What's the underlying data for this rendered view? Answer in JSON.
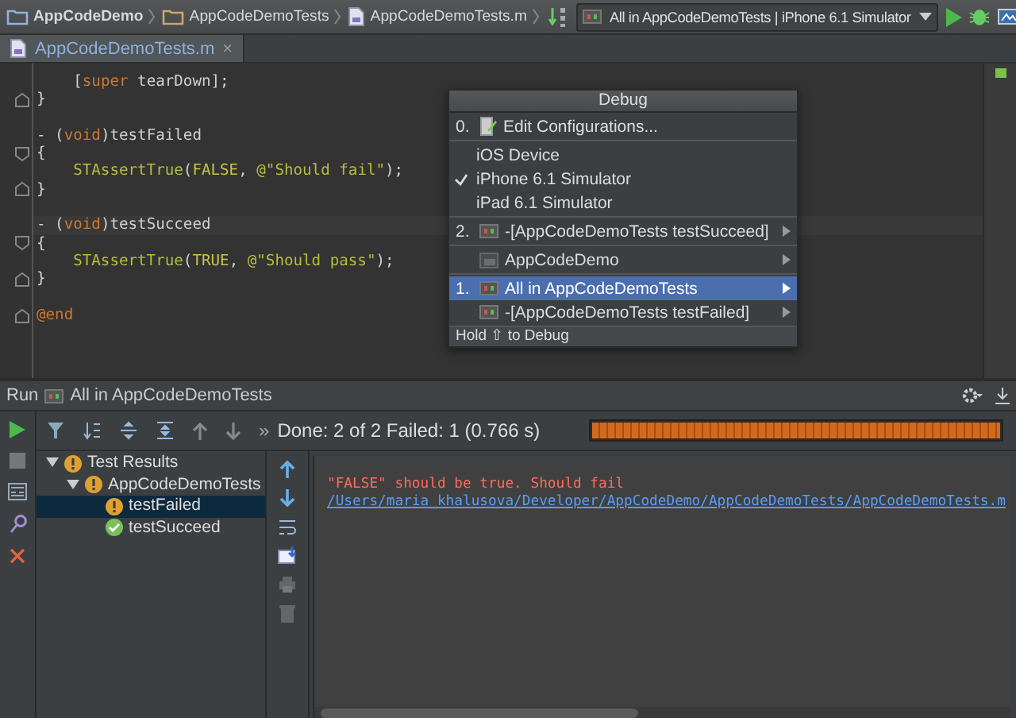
{
  "navbar": {
    "breadcrumbs": [
      {
        "label": "AppCodeDemo",
        "kind": "project"
      },
      {
        "label": "AppCodeDemoTests",
        "kind": "folder"
      },
      {
        "label": "AppCodeDemoTests.m",
        "kind": "file"
      }
    ],
    "run_config": "All in AppCodeDemoTests | iPhone 6.1 Simulator"
  },
  "tabs": [
    {
      "label": "AppCodeDemoTests.m",
      "close": "×",
      "selected": true
    }
  ],
  "editor": {
    "lines": [
      {
        "kind": "code",
        "tokens": [
          {
            "kind": "plain",
            "text": "    ["
          },
          {
            "kind": "keyword",
            "text": "super"
          },
          {
            "kind": "plain",
            "text": " tearDown];"
          }
        ]
      },
      {
        "kind": "fold_end",
        "tokens": [
          {
            "kind": "plain",
            "text": "}"
          }
        ]
      },
      {
        "kind": "blank"
      },
      {
        "kind": "code",
        "tokens": [
          {
            "kind": "plain",
            "text": "- ("
          },
          {
            "kind": "keyword",
            "text": "void"
          },
          {
            "kind": "plain",
            "text": ")testFailed"
          }
        ]
      },
      {
        "kind": "fold_start",
        "tokens": [
          {
            "kind": "plain",
            "text": "{"
          }
        ]
      },
      {
        "kind": "code",
        "tokens": [
          {
            "kind": "macro",
            "text": "    STAssertTrue"
          },
          {
            "kind": "plain",
            "text": "("
          },
          {
            "kind": "constant",
            "text": "FALSE"
          },
          {
            "kind": "plain",
            "text": ", "
          },
          {
            "kind": "string",
            "text": "@\"Should fail\""
          },
          {
            "kind": "plain",
            "text": ");"
          }
        ]
      },
      {
        "kind": "fold_end",
        "tokens": [
          {
            "kind": "plain",
            "text": "}"
          }
        ]
      },
      {
        "kind": "blank"
      },
      {
        "kind": "code",
        "current": true,
        "tokens": [
          {
            "kind": "plain",
            "text": "- ("
          },
          {
            "kind": "keyword",
            "text": "void"
          },
          {
            "kind": "plain",
            "text": ")testSucceed"
          }
        ]
      },
      {
        "kind": "fold_start",
        "tokens": [
          {
            "kind": "plain",
            "text": "{"
          }
        ]
      },
      {
        "kind": "code",
        "tokens": [
          {
            "kind": "macro",
            "text": "    STAssertTrue"
          },
          {
            "kind": "plain",
            "text": "("
          },
          {
            "kind": "constant",
            "text": "TRUE"
          },
          {
            "kind": "plain",
            "text": ", "
          },
          {
            "kind": "string",
            "text": "@\"Should pass\""
          },
          {
            "kind": "plain",
            "text": ");"
          }
        ]
      },
      {
        "kind": "fold_end",
        "tokens": [
          {
            "kind": "plain",
            "text": "}"
          }
        ]
      },
      {
        "kind": "blank"
      },
      {
        "kind": "fold_end",
        "tokens": [
          {
            "kind": "keyword",
            "text": "@end"
          }
        ]
      }
    ]
  },
  "debug_menu": {
    "title": "Debug",
    "groups": [
      [
        {
          "kind": "action",
          "number": "0.",
          "label": "Edit Configurations...",
          "selected": false
        }
      ],
      [
        {
          "kind": "device",
          "label": "iOS Device",
          "checked": false
        },
        {
          "kind": "device",
          "label": "iPhone 6.1 Simulator",
          "checked": true
        },
        {
          "kind": "device",
          "label": "iPad 6.1 Simulator",
          "checked": false
        }
      ],
      [
        {
          "kind": "test_config",
          "number": "2.",
          "label": "-[AppCodeDemoTests testSucceed]",
          "selected": false
        }
      ],
      [
        {
          "kind": "app_config",
          "label": "AppCodeDemo",
          "selected": false
        }
      ],
      [
        {
          "kind": "test_config",
          "number": "1.",
          "label": "All in AppCodeDemoTests",
          "selected": true
        },
        {
          "kind": "test_config",
          "label": "-[AppCodeDemoTests testFailed]",
          "selected": false
        }
      ]
    ],
    "footer": "Hold ⇧ to Debug"
  },
  "run_panel": {
    "title": "Run",
    "config": "All in AppCodeDemoTests",
    "more": "»",
    "status": "Done: 2 of 2  Failed: 1  (0.766 s)",
    "progress": {
      "level": 1
    },
    "tree": [
      {
        "label": "Test Results",
        "passed": false,
        "expanded": true,
        "selected": false,
        "children": [
          {
            "label": "AppCodeDemoTests",
            "passed": false,
            "expanded": true,
            "selected": false,
            "children": [
              {
                "label": "testFailed",
                "passed": false,
                "selected": true
              },
              {
                "label": "testSucceed",
                "passed": true,
                "selected": false
              }
            ]
          }
        ]
      }
    ],
    "output": [
      {
        "kind": "error",
        "text": "\"FALSE\" should be true. Should fail"
      },
      {
        "kind": "link",
        "text": "/Users/maria_khalusova/Developer/AppCodeDemo/AppCodeDemoTests/AppCodeDemoTests.m"
      }
    ]
  }
}
